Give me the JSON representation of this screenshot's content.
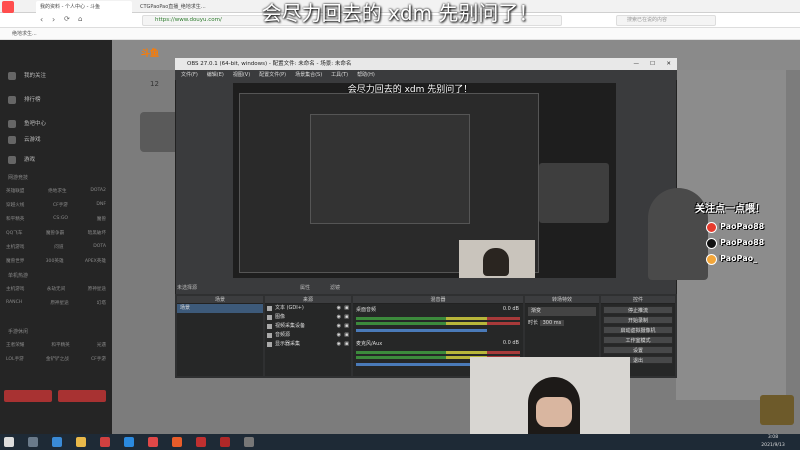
{
  "browser": {
    "tabs": [
      "我的资料 - 个人中心 - 斗鱼",
      "CTGPaoPao直播_绝地求生…"
    ],
    "url": "https://www.douyu.com/",
    "search_placeholder": "搜索已在说的内容",
    "bookmark": "绝地求生..."
  },
  "caption": "会尽力回去的 xdm 先别问了！",
  "nav": {
    "items": [
      "我的关注",
      "排行榜",
      "鱼吧中心",
      "云游戏",
      "游戏"
    ],
    "section1": "网游竞技",
    "grid1": [
      [
        "英雄联盟",
        "绝地求生",
        "DOTA2"
      ],
      [
        "穿越火线",
        "CF手游",
        "DNF"
      ],
      [
        "和平精英",
        "CS:GO",
        "魔兽"
      ],
      [
        "QQ飞车",
        "魔兽争霸",
        "暗黑破坏"
      ],
      [
        "主机游戏",
        "问道",
        "DOTA"
      ],
      [
        "魔兽世界",
        "300英雄",
        "APEX英雄"
      ]
    ],
    "section2": "单机热游",
    "grid2": [
      [
        "主机游戏",
        "永劫无间",
        "原神星途"
      ],
      [
        "RANCH",
        "原神星途",
        "幻塔"
      ]
    ],
    "section3": "手游休闲",
    "grid3": [
      [
        "王者荣耀",
        "和平精英",
        "光遇"
      ],
      [
        "LOL手游",
        "金铲铲之战",
        "CF手游"
      ]
    ]
  },
  "douyu": {
    "logo": "斗鱼",
    "room_number": "12"
  },
  "obs": {
    "title": "OBS 27.0.1 (64-bit, windows) - 配置文件: 未命名 - 场景: 未命名",
    "menu": [
      "文件(F)",
      "编辑(E)",
      "视图(V)",
      "配置文件(P)",
      "场景集合(S)",
      "工具(T)",
      "帮助(H)"
    ],
    "no_source": "未选择源",
    "props": "属性",
    "filters": "滤镜",
    "docks": [
      "场景",
      "来源",
      "混音器",
      "转场特效",
      "控件"
    ],
    "scene": "场景",
    "sources": [
      "文本 (GDI+)",
      "图像",
      "视频采集设备",
      "音频源",
      "显示器采集"
    ],
    "mixer": [
      {
        "name": "桌面音频",
        "db": "0.0 dB"
      },
      {
        "name": "麦克风/Aux",
        "db": "0.0 dB"
      }
    ],
    "transition": "渐变",
    "duration_label": "时长",
    "duration_value": "300 ms",
    "controls": [
      "停止推流",
      "开始录制",
      "启动虚拟摄像机",
      "工作室模式",
      "设置",
      "退出"
    ]
  },
  "follow": {
    "title": "关注点一点喂！",
    "handles": [
      {
        "name": "PaoPao88",
        "color": "#e63b2e"
      },
      {
        "name": "PaoPao88",
        "color": "#111111"
      },
      {
        "name": "PaoPao_",
        "color": "#f2a63a"
      }
    ]
  },
  "taskbar": {
    "time": "3:08",
    "date": "2021/9/13"
  }
}
